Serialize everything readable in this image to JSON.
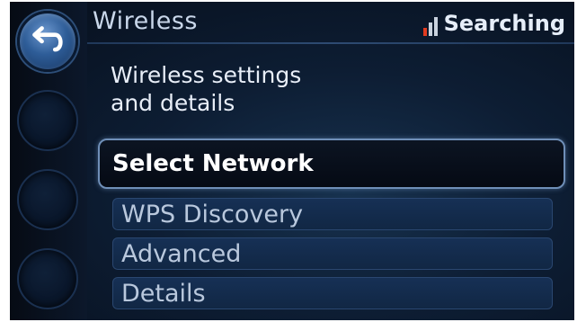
{
  "header": {
    "title": "Wireless",
    "status": "Searching",
    "signal_icon": "signal-bars-icon"
  },
  "sidebar": {
    "back_icon": "back-arrow-icon"
  },
  "main": {
    "subtitle_line1": "Wireless settings",
    "subtitle_line2": "and details",
    "menu": [
      {
        "label": "Select Network",
        "selected": true
      },
      {
        "label": "WPS Discovery",
        "selected": false
      },
      {
        "label": "Advanced",
        "selected": false
      },
      {
        "label": "Details",
        "selected": false
      }
    ]
  },
  "colors": {
    "accent_blue": "#2e5d98",
    "signal_red": "#e23b1f",
    "menu_item_bg": "#163055",
    "selected_border": "#6f8fb8"
  }
}
